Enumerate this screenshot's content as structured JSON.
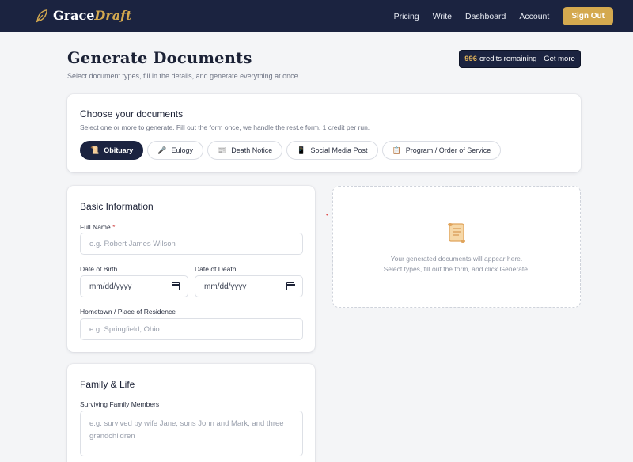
{
  "nav": {
    "logo_grace": "Grace",
    "logo_draft": "Draft",
    "links": [
      "Pricing",
      "Write",
      "Dashboard",
      "Account"
    ],
    "signout_label": "Sign Out"
  },
  "header": {
    "title": "Generate Documents",
    "subtitle": "Select document types, fill in the details, and generate everything at once."
  },
  "credits": {
    "count": "996",
    "text": "credits remaining ·",
    "link": "Get more"
  },
  "choose": {
    "heading": "Choose your documents",
    "description": "Select one or more to generate. Fill out the form once, we handle the rest.e form. 1 credit per run.",
    "chips": [
      {
        "label": "Obituary",
        "icon": "📜",
        "active": true
      },
      {
        "label": "Eulogy",
        "icon": "🎤",
        "active": false
      },
      {
        "label": "Death Notice",
        "icon": "📰",
        "active": false
      },
      {
        "label": "Social Media Post",
        "icon": "📱",
        "active": false
      },
      {
        "label": "Program / Order of Service",
        "icon": "📋",
        "active": false
      }
    ]
  },
  "basic": {
    "heading": "Basic Information",
    "full_name_label": "Full Name",
    "required_mark": "*",
    "full_name_placeholder": "e.g. Robert James Wilson",
    "dob_label": "Date of Birth",
    "dob_value": "mm/dd/yyyy",
    "dod_label": "Date of Death",
    "dod_value": "mm/dd/yyyy",
    "hometown_label": "Hometown / Place of Residence",
    "hometown_placeholder": "e.g. Springfield, Ohio"
  },
  "family": {
    "heading": "Family & Life",
    "members_label": "Surviving Family Members",
    "members_placeholder": "e.g. survived by wife Jane, sons John and Mark, and three grandchildren"
  },
  "output": {
    "line1": "Your generated documents will appear here.",
    "line2": "Select types, fill out the form, and click Generate."
  },
  "colors": {
    "navy": "#1b2340",
    "gold": "#d4a94f",
    "background": "#f4f5f7"
  }
}
